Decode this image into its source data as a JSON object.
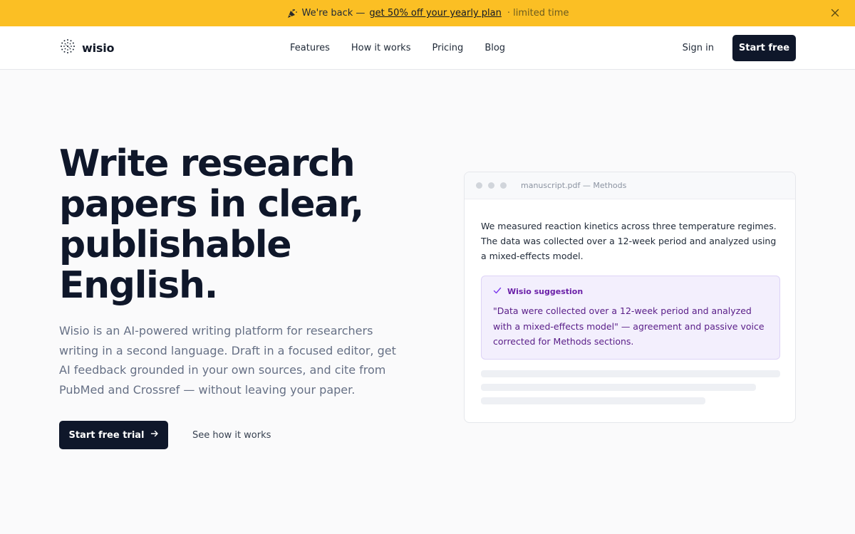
{
  "announcement": {
    "lead": "We're back —",
    "link": "get 50% off your yearly plan",
    "note": "· limited time",
    "icon": "party-popper-icon",
    "close_icon": "close-icon"
  },
  "header": {
    "logo_text": "wisio",
    "nav": [
      "Features",
      "How it works",
      "Pricing",
      "Blog"
    ],
    "signin": "Sign in",
    "start_free": "Start free"
  },
  "hero": {
    "title": "Write research papers in clear, publishable English.",
    "subtitle": "Wisio is an AI-powered writing platform for researchers writing in a second language. Draft in a focused editor, get AI feedback grounded in your own sources, and cite from PubMed and Crossref — without leaving your paper.",
    "primary_cta": "Start free trial",
    "secondary_cta": "See how it works"
  },
  "editor_card": {
    "title": "manuscript.pdf — Methods",
    "body": "We measured reaction kinetics across three temperature regimes. The data was collected over a 12-week period and analyzed using a mixed-effects model.",
    "suggestion_label": "Wisio suggestion",
    "suggestion_text": "\"Data were collected over a 12-week period and analyzed with a mixed-effects model\" — agreement and passive voice corrected for Methods sections."
  },
  "colors": {
    "announce_bg": "#fbbf24",
    "primary_dark": "#0f172a",
    "suggestion_bg": "#f3effd",
    "suggestion_text": "#581c87"
  }
}
